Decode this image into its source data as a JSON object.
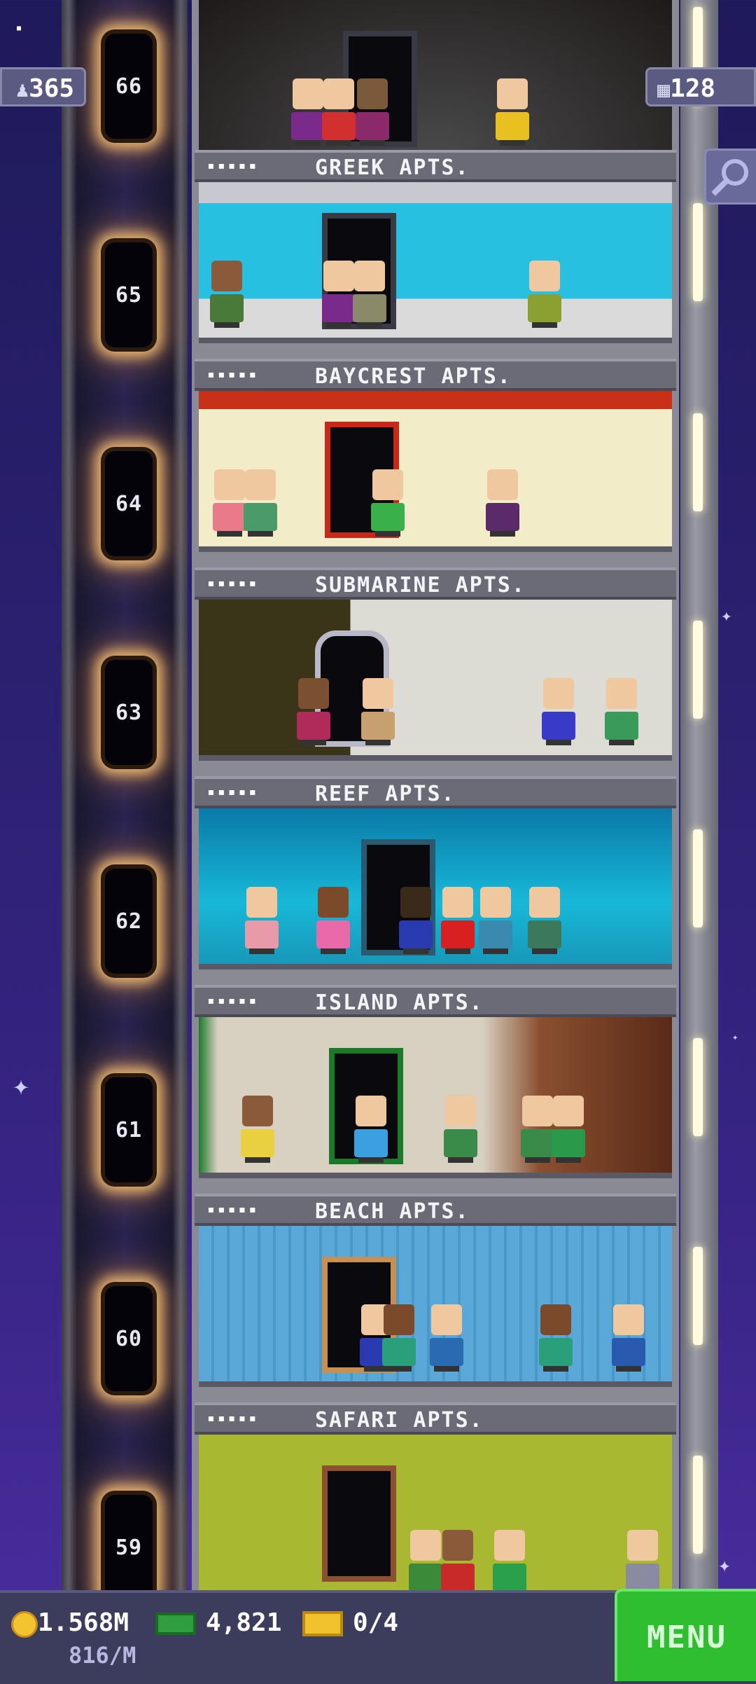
{
  "hud": {
    "population": "365",
    "floors_count": "128"
  },
  "floors": [
    {
      "number": "66",
      "label_after": "GREEK APTS."
    },
    {
      "number": "65",
      "label_after": "BAYCREST APTS."
    },
    {
      "number": "64",
      "label_after": "SUBMARINE APTS."
    },
    {
      "number": "63",
      "label_after": "REEF APTS."
    },
    {
      "number": "62",
      "label_after": "ISLAND APTS."
    },
    {
      "number": "61",
      "label_after": "BEACH APTS."
    },
    {
      "number": "60",
      "label_after": "SAFARI APTS."
    },
    {
      "number": "59",
      "label_after": ""
    }
  ],
  "label_dots": "▪▪▪▪▪",
  "bottom": {
    "coins": "1.568M",
    "bux": "4,821",
    "tickets": "0/4",
    "rate": "816/M",
    "menu_label": "MENU"
  },
  "colors": {
    "menu": "#2fbe2f",
    "coin": "#f4c430",
    "bux": "#2e9e3e",
    "ticket": "#f2c12e"
  }
}
